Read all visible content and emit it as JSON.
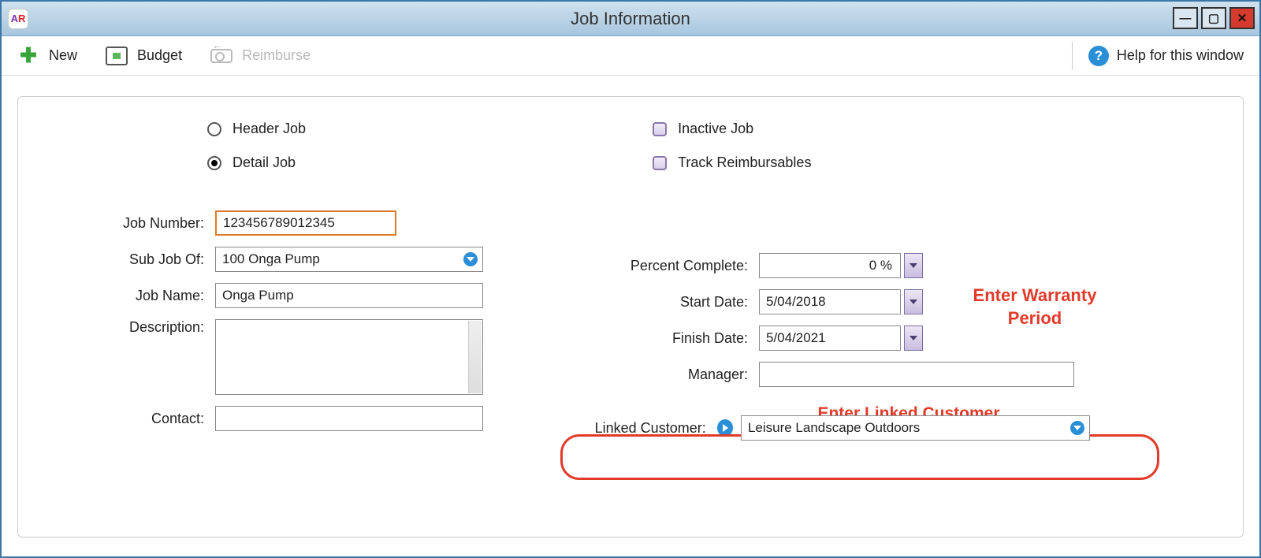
{
  "app_badge": {
    "a": "A",
    "r": "R"
  },
  "window_title": "Job Information",
  "toolbar": {
    "new_label": "New",
    "budget_label": "Budget",
    "reimburse_label": "Reimburse",
    "help_label": "Help for this window"
  },
  "options": {
    "header_job": "Header Job",
    "detail_job": "Detail Job",
    "inactive_job": "Inactive Job",
    "track_reimbursables": "Track Reimbursables"
  },
  "labels": {
    "job_number": "Job Number:",
    "sub_job_of": "Sub Job Of:",
    "job_name": "Job Name:",
    "description": "Description:",
    "contact": "Contact:",
    "percent_complete": "Percent Complete:",
    "start_date": "Start Date:",
    "finish_date": "Finish Date:",
    "manager": "Manager:",
    "linked_customer": "Linked Customer:"
  },
  "values": {
    "job_number": "123456789012345",
    "sub_job_of": "100 Onga Pump",
    "job_name": "Onga Pump",
    "description": "",
    "contact": "",
    "percent_complete": "0 %",
    "start_date": "5/04/2018",
    "finish_date": "5/04/2021",
    "manager": "",
    "linked_customer": "Leisure Landscape Outdoors"
  },
  "annotations": {
    "warranty": "Enter Warranty Period",
    "linked": "Enter Linked Customer"
  }
}
